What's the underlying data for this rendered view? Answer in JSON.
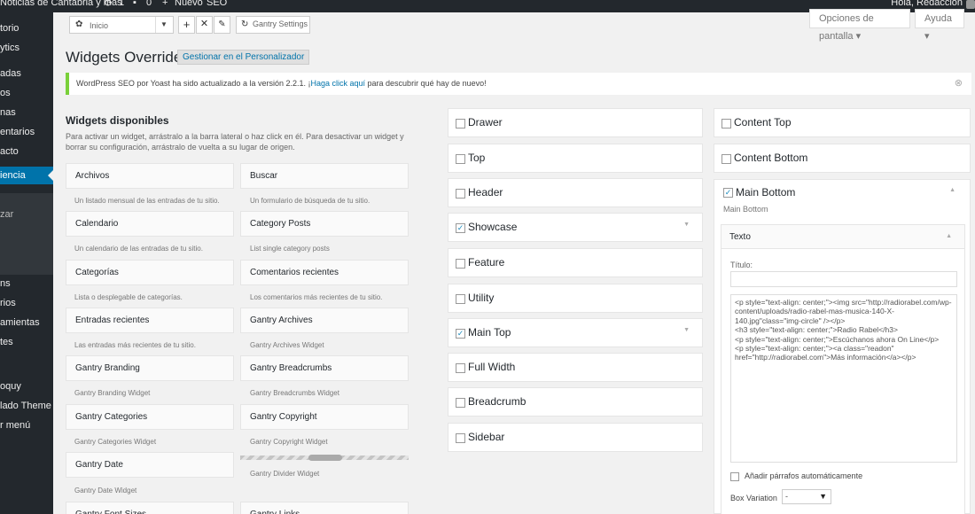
{
  "admin_bar": {
    "site_name": "Noticias de Cantabria y más",
    "updates_count": "1",
    "comments_count": "0",
    "new_label": "Nuevo",
    "seo_label": "SEO",
    "greeting": "Hola, Redacción"
  },
  "side_menu": {
    "items": [
      "torio",
      "ytics",
      "adas",
      "os",
      "nas",
      "entarios",
      "acto",
      "iencia",
      "zar",
      "ns",
      "rios",
      "amientas",
      "tes",
      "oquy",
      "lado Theme",
      "r menú"
    ]
  },
  "toolbar": {
    "outline_label": "Inicio",
    "gantry_settings": "Gantry Settings",
    "screen_options": "Opciones de pantalla ▾",
    "help": "Ayuda ▾"
  },
  "page": {
    "title": "Widgets Override",
    "manage_button": "Gestionar en el Personalizador"
  },
  "notice": {
    "text_before": "WordPress SEO por Yoast ha sido actualizado a la versión 2.2.1. ¡",
    "link": "Haga click aquí",
    "text_after": " para descubrir qué hay de nuevo!"
  },
  "available": {
    "title": "Widgets disponibles",
    "description": "Para activar un widget, arrástralo a la barra lateral o haz click en él. Para desactivar un widget y borrar su configuración, arrástralo de vuelta a su lugar de origen.",
    "widgets": [
      {
        "name": "Archivos",
        "desc": "Un listado mensual de las entradas de tu sitio."
      },
      {
        "name": "Buscar",
        "desc": "Un formulario de búsqueda de tu sitio."
      },
      {
        "name": "Calendario",
        "desc": "Un calendario de las entradas de tu sitio."
      },
      {
        "name": "Category Posts",
        "desc": "List single category posts"
      },
      {
        "name": "Categorías",
        "desc": "Lista o desplegable de categorías."
      },
      {
        "name": "Comentarios recientes",
        "desc": "Los comentarios más recientes de tu sitio."
      },
      {
        "name": "Entradas recientes",
        "desc": "Las entradas más recientes de tu sitio."
      },
      {
        "name": "Gantry Archives",
        "desc": "Gantry Archives Widget"
      },
      {
        "name": "Gantry Branding",
        "desc": "Gantry Branding Widget"
      },
      {
        "name": "Gantry Breadcrumbs",
        "desc": "Gantry Breadcrumbs Widget"
      },
      {
        "name": "Gantry Categories",
        "desc": "Gantry Categories Widget"
      },
      {
        "name": "Gantry Copyright",
        "desc": "Gantry Copyright Widget"
      },
      {
        "name": "Gantry Date",
        "desc": "Gantry Date Widget"
      },
      {
        "name": "",
        "desc": "Gantry Divider Widget"
      },
      {
        "name": "Gantry Font Sizes",
        "desc": ""
      },
      {
        "name": "Gantry Links",
        "desc": ""
      }
    ]
  },
  "sidebars_middle": [
    {
      "name": "Drawer",
      "checked": false,
      "toggle": false
    },
    {
      "name": "Top",
      "checked": false,
      "toggle": false
    },
    {
      "name": "Header",
      "checked": false,
      "toggle": false
    },
    {
      "name": "Showcase",
      "checked": true,
      "toggle": true
    },
    {
      "name": "Feature",
      "checked": false,
      "toggle": false
    },
    {
      "name": "Utility",
      "checked": false,
      "toggle": false
    },
    {
      "name": "Main Top",
      "checked": true,
      "toggle": true
    },
    {
      "name": "Full Width",
      "checked": false,
      "toggle": false
    },
    {
      "name": "Breadcrumb",
      "checked": false,
      "toggle": false
    },
    {
      "name": "Sidebar",
      "checked": false,
      "toggle": false
    }
  ],
  "sidebars_right": [
    {
      "name": "Content Top",
      "checked": false
    },
    {
      "name": "Content Bottom",
      "checked": false
    }
  ],
  "main_bottom": {
    "name": "Main Bottom",
    "checked": true,
    "subtitle": "Main Bottom",
    "widget_title": "Texto",
    "titulo_label": "Título:",
    "titulo_value": "",
    "text": "<p style=\"text-align: center;\"><img src=\"http://radiorabel.com/wp-content/uploads/radio-rabel-mas-musica-140-X-140.jpg\"class=\"img-circle\" /></p>\n<h3 style=\"text-align: center;\">Radio Rabel</h3>\n<p style=\"text-align: center;\">Escúchanos ahora On Line</p>\n<p style=\"text-align: center;\"><a class=\"readon\" href=\"http://radiorabel.com\">Más información</a></p>",
    "auto_paragraphs": "Añadir párrafos automáticamente",
    "box_variation_label": "Box Variation",
    "box_variation_value": "-"
  },
  "colors": {
    "admin_bar": "#23282d",
    "accent": "#0073aa",
    "notice_border": "#7ad03a"
  }
}
